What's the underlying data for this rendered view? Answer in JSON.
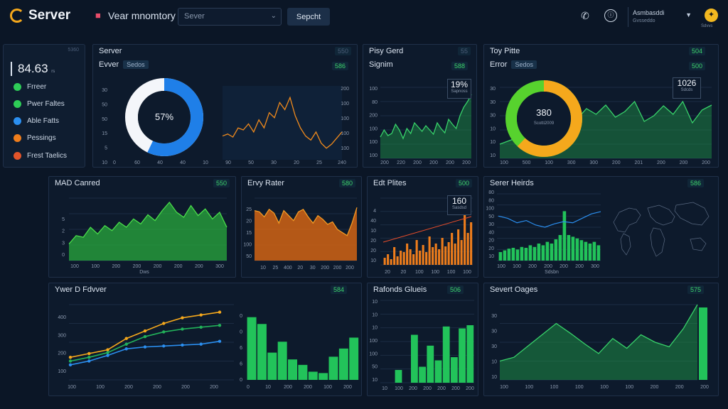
{
  "header": {
    "logo": "Server",
    "title": "Vear mnomtory",
    "select_value": "Sever",
    "search_label": "Sepcht",
    "account_name": "Asmbasddi",
    "account_sub": "Gvsseddo",
    "avatar_caption": "Sdvvs"
  },
  "sidebar": {
    "tag": "5360",
    "metric": "84.63",
    "metric_unit": "rs",
    "items": [
      {
        "label": "Frreer",
        "color": "#2ecc57"
      },
      {
        "label": "Pwer Faltes",
        "color": "#2ecc57"
      },
      {
        "label": "Able Fatts",
        "color": "#2b8ff0"
      },
      {
        "label": "Pessings",
        "color": "#ee7d1c"
      },
      {
        "label": "Frest Taelics",
        "color": "#e2542a"
      }
    ]
  },
  "panels": {
    "server": {
      "title": "Server",
      "badge": "550",
      "sub": "Evver",
      "chip": "Sedos",
      "badge2": "586",
      "donut_label": "57%",
      "y_ticks": [
        "30",
        "50",
        "50",
        "15",
        "5",
        "10"
      ],
      "x_ticks": [
        "0",
        "60",
        "40",
        "40",
        "10",
        "90",
        "50",
        "30",
        "20",
        "25",
        "240"
      ],
      "y_right": [
        "200",
        "100",
        "100",
        "100",
        "100"
      ]
    },
    "play_gerd": {
      "title": "Pisy Gerd",
      "badge": "55",
      "sub": "Signim",
      "badge2": "588",
      "callout_value": "19%",
      "callout_label": "Sapnoss",
      "y_ticks": [
        "100",
        "80",
        "200",
        "100",
        "100",
        "100"
      ],
      "x_ticks": [
        "200",
        "220",
        "200",
        "200",
        "200",
        "200"
      ]
    },
    "toy_pitte": {
      "title": "Toy Pitte",
      "badge": "504",
      "sub": "Error",
      "chip": "Sedos",
      "badge2": "500",
      "donut_value": "380",
      "donut_label": "Scotti2009",
      "callout_value": "1026",
      "callout_label": "Sdcds",
      "y_ticks": [
        "30",
        "30",
        "30",
        "10",
        "10",
        "10"
      ],
      "x_ticks": [
        "100",
        "500",
        "100",
        "300",
        "300",
        "200",
        "201",
        "200",
        "200",
        "200"
      ]
    },
    "mad_canred": {
      "title": "MAD Canred",
      "badge": "550",
      "y_ticks": [
        "5",
        "2",
        "3",
        "0"
      ],
      "x_ticks": [
        "100",
        "100",
        "200",
        "200",
        "200",
        "200",
        "200",
        "300"
      ],
      "x_caption": "Dws"
    },
    "errv_rater": {
      "title": "Ervy Rater",
      "badge": "580",
      "y_ticks": [
        "25",
        "20",
        "15",
        "100",
        "50"
      ],
      "x_ticks": [
        "10",
        "25",
        "400",
        "20",
        "30",
        "200",
        "200",
        "200"
      ]
    },
    "edt_plites": {
      "title": "Edt Plites",
      "badge": "500",
      "callout_value": "160",
      "callout_label": "Sasdsd",
      "y_ticks": [
        "4",
        "40",
        "10",
        "20",
        "20",
        "10"
      ],
      "x_ticks": [
        "20",
        "20",
        "100",
        "100",
        "100",
        "100"
      ]
    },
    "serer_heirds": {
      "title": "Serer Heirds",
      "badge": "586",
      "y_ticks": [
        "80",
        "80",
        "100",
        "50",
        "30",
        "40",
        "20",
        "20",
        "10"
      ],
      "x_ticks": [
        "100",
        "100",
        "200",
        "200",
        "200",
        "200",
        "300"
      ],
      "x_caption": "Sdsbn"
    },
    "ywer": {
      "title": "Ywer D Fdvver",
      "badge": "584",
      "y_ticks": [
        "400",
        "300",
        "200",
        "100"
      ],
      "x_ticks": [
        "100",
        "100",
        "200",
        "200",
        "200",
        "200"
      ],
      "y_right": [
        "0",
        "0",
        "6",
        "6",
        "0"
      ],
      "x_ticks2": [
        "0",
        "10",
        "200",
        "200",
        "100",
        "200"
      ]
    },
    "rafonds": {
      "title": "Rafonds Glueis",
      "badge": "506",
      "y_ticks": [
        "10",
        "10",
        "10",
        "100",
        "100",
        "50",
        "10"
      ],
      "x_ticks": [
        "10",
        "100",
        "200",
        "200",
        "200",
        "200",
        "200"
      ]
    },
    "severt_oages": {
      "title": "Severt Oages",
      "badge": "575",
      "y_ticks": [
        "30",
        "30",
        "30",
        "10",
        "10"
      ],
      "x_ticks": [
        "100",
        "100",
        "100",
        "100",
        "100",
        "100",
        "200",
        "200",
        "200"
      ]
    }
  },
  "chart_data": [
    {
      "type": "donut",
      "panel": "Server",
      "values": [
        57,
        43
      ],
      "label": "57%"
    },
    {
      "type": "line",
      "panel": "Server",
      "values": [
        22,
        24,
        21,
        30,
        28,
        34,
        26,
        38,
        30,
        45,
        40,
        55,
        48,
        60,
        42,
        30,
        22,
        18,
        26,
        15,
        10,
        14,
        20,
        26
      ]
    },
    {
      "type": "area",
      "panel": "Pisy Gerd",
      "values": [
        30,
        40,
        32,
        35,
        48,
        40,
        28,
        42,
        35,
        50,
        44,
        38,
        46,
        40,
        34,
        50,
        42,
        36,
        55,
        48,
        42,
        60,
        72,
        80,
        90
      ]
    },
    {
      "type": "donut",
      "panel": "Toy Pitte",
      "values": [
        62,
        38
      ],
      "label": "380"
    },
    {
      "type": "area",
      "panel": "Toy Pitte",
      "values": [
        20,
        25,
        30,
        45,
        40,
        50,
        42,
        60,
        55,
        70,
        62,
        75,
        58,
        66,
        80,
        52,
        60,
        74,
        62,
        80,
        50,
        68,
        75
      ]
    },
    {
      "type": "area",
      "panel": "MAD Canred",
      "values": [
        20,
        30,
        28,
        40,
        32,
        42,
        36,
        46,
        40,
        50,
        44,
        55,
        48,
        60,
        70,
        58,
        52,
        66,
        54,
        62,
        50,
        58,
        40
      ]
    },
    {
      "type": "area",
      "panel": "Ervy Rater",
      "values": [
        80,
        78,
        70,
        82,
        76,
        60,
        80,
        72,
        64,
        78,
        82,
        70,
        60,
        72,
        66,
        58,
        62,
        50,
        45,
        40,
        60,
        85
      ]
    },
    {
      "type": "bar",
      "panel": "Edt Plites",
      "values": [
        10,
        15,
        8,
        25,
        12,
        20,
        18,
        30,
        22,
        15,
        35,
        20,
        28,
        18,
        40,
        25,
        30,
        22,
        38,
        26,
        32,
        45,
        30,
        50,
        35,
        70,
        45,
        60
      ]
    },
    {
      "type": "bar",
      "panel": "Serer Heirds",
      "values": [
        10,
        12,
        14,
        15,
        13,
        16,
        15,
        18,
        16,
        20,
        18,
        22,
        20,
        25,
        30,
        58,
        30,
        28,
        26,
        24,
        22,
        20,
        22,
        18
      ]
    },
    {
      "type": "line",
      "panel": "Ywer D Fdvver",
      "series": [
        {
          "values": [
            120,
            140,
            160,
            220,
            260,
            300,
            330,
            345,
            360
          ]
        },
        {
          "values": [
            100,
            120,
            145,
            190,
            230,
            255,
            270,
            280,
            290
          ]
        },
        {
          "values": [
            80,
            100,
            130,
            165,
            175,
            180,
            185,
            190,
            205
          ]
        }
      ]
    },
    {
      "type": "bar",
      "panel": "Ywer D Fdvver",
      "values": [
        92,
        82,
        40,
        56,
        30,
        22,
        12,
        10,
        34,
        46,
        62
      ]
    },
    {
      "type": "bar",
      "panel": "Rafonds Glueis",
      "values": [
        20,
        0,
        75,
        25,
        58,
        35,
        88,
        40,
        85,
        90
      ]
    },
    {
      "type": "area",
      "panel": "Severt Oages",
      "values": [
        25,
        30,
        45,
        60,
        75,
        62,
        48,
        35,
        55,
        42,
        60,
        50,
        44,
        68,
        100
      ]
    }
  ]
}
